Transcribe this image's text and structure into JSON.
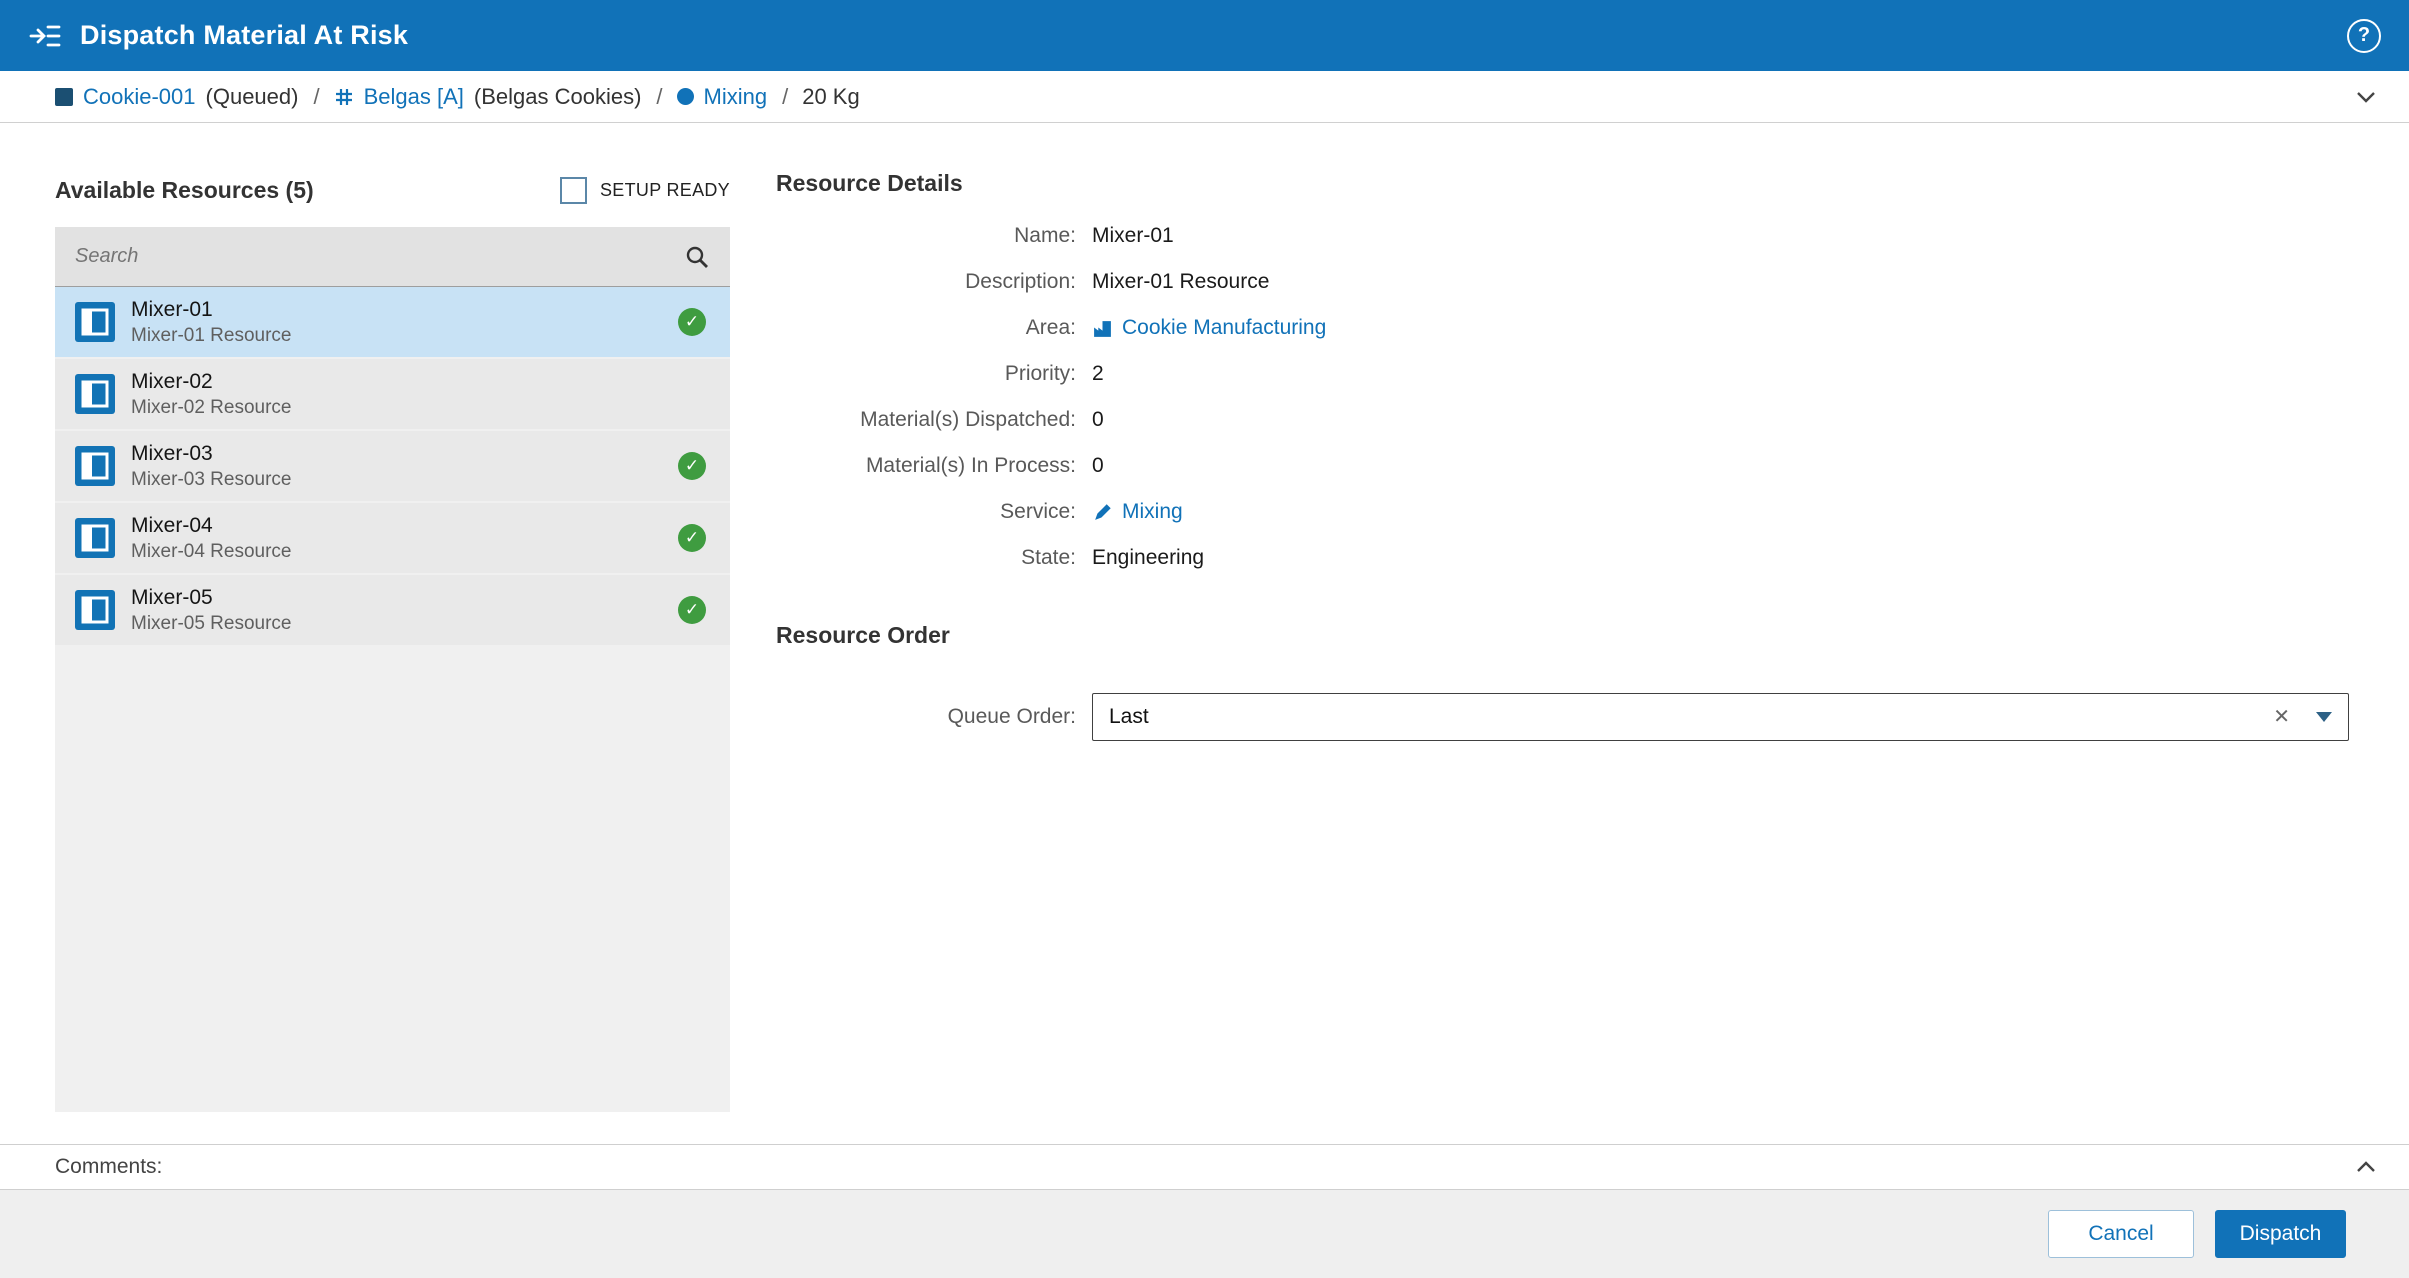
{
  "colors": {
    "accent": "#1172b8",
    "header-bg": "#1172b8",
    "selected-row": "#c8e2f5",
    "ready-green": "#3f9c40",
    "panel-bg": "#f0f0f0",
    "row-bg": "#e9e9e9",
    "search-bg": "#e2e2e2",
    "footer-bg": "#efefef",
    "label-text": "#595959",
    "text": "#1f1f1f"
  },
  "icons": {
    "help": "?",
    "check": "✓",
    "clear": "✕"
  },
  "titlebar": {
    "title": "Dispatch Material At Risk"
  },
  "breadcrumb": {
    "segments": [
      {
        "label": "Cookie-001",
        "detail": "(Queued)",
        "separator": "/"
      },
      {
        "label": "Belgas [A]",
        "detail": "(Belgas Cookies)",
        "separator": "/"
      },
      {
        "label": "Mixing",
        "detail": "",
        "separator": "/"
      },
      {
        "label": "20 Kg",
        "detail": "",
        "separator": ""
      }
    ]
  },
  "resources": {
    "heading": "Available Resources (5)",
    "setup_ready_label": "SETUP READY",
    "setup_ready_checked": false,
    "search_placeholder": "Search",
    "items": [
      {
        "name": "Mixer-01",
        "description": "Mixer-01 Resource",
        "selected": true,
        "ready": true
      },
      {
        "name": "Mixer-02",
        "description": "Mixer-02 Resource",
        "selected": false,
        "ready": false
      },
      {
        "name": "Mixer-03",
        "description": "Mixer-03 Resource",
        "selected": false,
        "ready": true
      },
      {
        "name": "Mixer-04",
        "description": "Mixer-04 Resource",
        "selected": false,
        "ready": true
      },
      {
        "name": "Mixer-05",
        "description": "Mixer-05 Resource",
        "selected": false,
        "ready": true
      }
    ]
  },
  "details": {
    "heading": "Resource Details",
    "fields": [
      {
        "label": "Name:",
        "value": "Mixer-01"
      },
      {
        "label": "Description:",
        "value": "Mixer-01 Resource"
      },
      {
        "label": "Area:",
        "value": "Cookie Manufacturing",
        "link": true
      },
      {
        "label": "Priority:",
        "value": "2"
      },
      {
        "label": "Material(s) Dispatched:",
        "value": "0"
      },
      {
        "label": "Material(s) In Process:",
        "value": "0"
      },
      {
        "label": "Service:",
        "value": "Mixing",
        "link": true
      },
      {
        "label": "State:",
        "value": "Engineering"
      }
    ]
  },
  "resource_order": {
    "heading": "Resource Order",
    "queue_order_label": "Queue Order:",
    "queue_order_value": "Last"
  },
  "comments": {
    "label": "Comments:"
  },
  "footer": {
    "cancel_label": "Cancel",
    "dispatch_label": "Dispatch"
  }
}
